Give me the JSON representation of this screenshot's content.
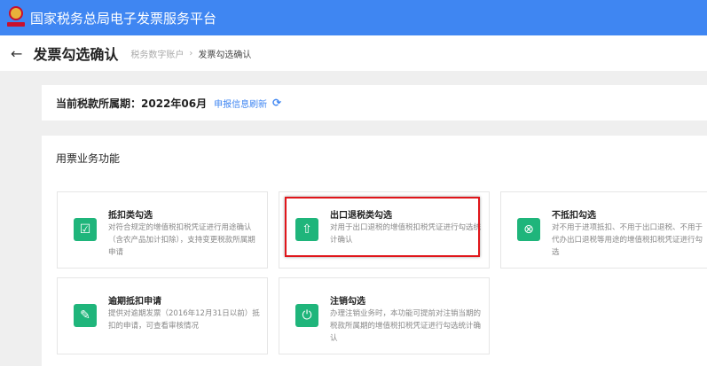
{
  "header": {
    "app_title": "国家税务总局电子发票服务平台"
  },
  "titlebar": {
    "title": "发票勾选确认",
    "breadcrumb": [
      "税务数字账户",
      "发票勾选确认"
    ]
  },
  "period": {
    "label": "当前税款所属期：2022年06月",
    "refresh": "申报信息刷新"
  },
  "section": {
    "title": "用票业务功能",
    "cards": [
      {
        "title": "抵扣类勾选",
        "desc": "对符合规定的增值税扣税凭证进行用途确认（含农产品加计扣除），支持变更税款所属期申请",
        "icon": "deduct-check-icon"
      },
      {
        "title": "出口退税类勾选",
        "desc": "对用于出口退税的增值税扣税凭证进行勾选统计确认",
        "icon": "export-refund-icon"
      },
      {
        "title": "不抵扣勾选",
        "desc": "对不用于进项抵扣、不用于出口退税、不用于代办出口退税等用途的增值税扣税凭证进行勾选",
        "icon": "no-deduct-icon"
      },
      {
        "title": "逾期抵扣申请",
        "desc": "提供对逾期发票（2016年12月31日以前）抵扣的申请，可查看审核情况",
        "icon": "overdue-apply-icon"
      },
      {
        "title": "注销勾选",
        "desc": "办理注销业务时，本功能可提前对注销当期的税款所属期的增值税扣税凭证进行勾选统计确认",
        "icon": "cancel-check-icon"
      }
    ]
  }
}
